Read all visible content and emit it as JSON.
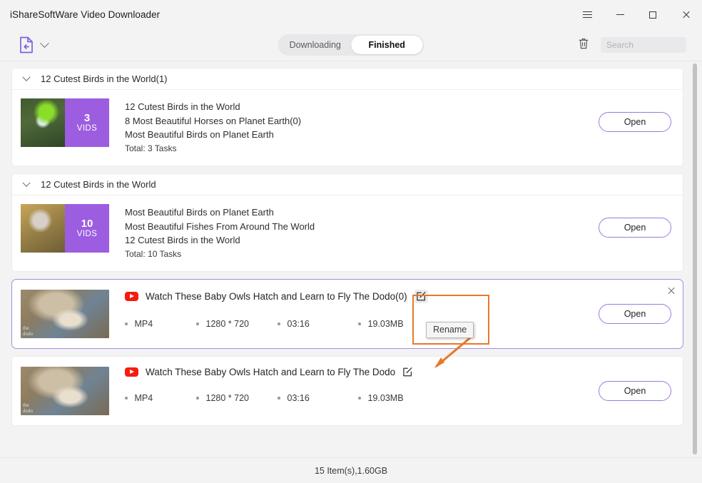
{
  "window": {
    "title": "iShareSoftWare Video Downloader",
    "controls": {
      "menu": "menu-icon",
      "minimize": "minimize-icon",
      "maximize": "maximize-icon",
      "close": "close-icon"
    }
  },
  "toolbar": {
    "import_icon": "file-import-icon",
    "dropdown_icon": "chevron-down-icon",
    "tabs": [
      {
        "label": "Downloading",
        "active": false
      },
      {
        "label": "Finished",
        "active": true
      }
    ],
    "trash_icon": "trash-icon",
    "search": {
      "placeholder": "Search",
      "value": ""
    }
  },
  "groups": [
    {
      "title": "12 Cutest Birds in the World(1)",
      "count": "3",
      "count_unit": "VIDS",
      "lines": [
        "12 Cutest Birds in the World",
        "8 Most Beautiful Horses on Planet Earth(0)",
        "Most Beautiful Birds on Planet Earth"
      ],
      "total": "Total: 3 Tasks",
      "open_label": "Open"
    },
    {
      "title": "12 Cutest Birds in the World",
      "count": "10",
      "count_unit": "VIDS",
      "lines": [
        "Most Beautiful Birds on Planet Earth",
        "Most Beautiful Fishes From Around The World",
        "12 Cutest Birds in the World"
      ],
      "total": "Total: 10 Tasks",
      "open_label": "Open"
    }
  ],
  "tasks": [
    {
      "title": "Watch These Baby Owls Hatch and Learn to Fly  The Dodo(0)",
      "source_icon": "youtube-icon",
      "rename_icon": "edit-rename-icon",
      "format": "MP4",
      "resolution": "1280 * 720",
      "duration": "03:16",
      "size": "19.03MB",
      "open_label": "Open",
      "selected": true,
      "close_icon": "close-icon"
    },
    {
      "title": "Watch These Baby Owls Hatch and Learn to Fly  The Dodo",
      "source_icon": "youtube-icon",
      "rename_icon": "edit-rename-icon",
      "format": "MP4",
      "resolution": "1280 * 720",
      "duration": "03:16",
      "size": "19.03MB",
      "open_label": "Open",
      "selected": false
    }
  ],
  "annotation": {
    "tooltip": "Rename",
    "highlight_color": "#e8782a",
    "arrow_color": "#e8782a"
  },
  "statusbar": {
    "summary": "15 Item(s),1.60GB"
  },
  "colors": {
    "accent_purple": "#9c5de0",
    "button_border": "#9c79e0",
    "selected_border": "#a98be3",
    "youtube_red": "#f61c0d"
  }
}
